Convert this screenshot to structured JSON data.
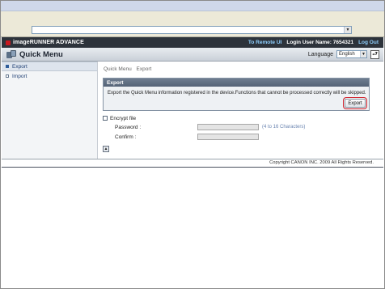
{
  "browser": {
    "address_value": ""
  },
  "header": {
    "brand": "imageRUNNER ADVANCE",
    "remote_ui_link": "To Remote UI",
    "login_user": "Login User Name: 7654321",
    "logout_link": "Log Out"
  },
  "titlebar": {
    "title": "Quick Menu",
    "language_label": "Language",
    "language_value": "English"
  },
  "sidebar": {
    "items": [
      {
        "label": "Export",
        "active": true
      },
      {
        "label": "Import",
        "active": false
      }
    ]
  },
  "breadcrumb": [
    "Quick Menu",
    "Export"
  ],
  "panel": {
    "heading": "Export",
    "description": "Export the Quick Menu information registered in the device.Functions that cannot be processed correctly will be skipped.",
    "export_button": "Export"
  },
  "form": {
    "encrypt_label": "Encrypt file",
    "password_label": "Password :",
    "password_hint": "(4 to 16 Characters)",
    "confirm_label": "Confirm :"
  },
  "footer": {
    "copyright": "Copyright CANON INC. 2009 All Rights Reserved."
  },
  "colors": {
    "header_bg": "#2d333b",
    "link": "#8fd0ff",
    "highlight": "#d2202a"
  }
}
